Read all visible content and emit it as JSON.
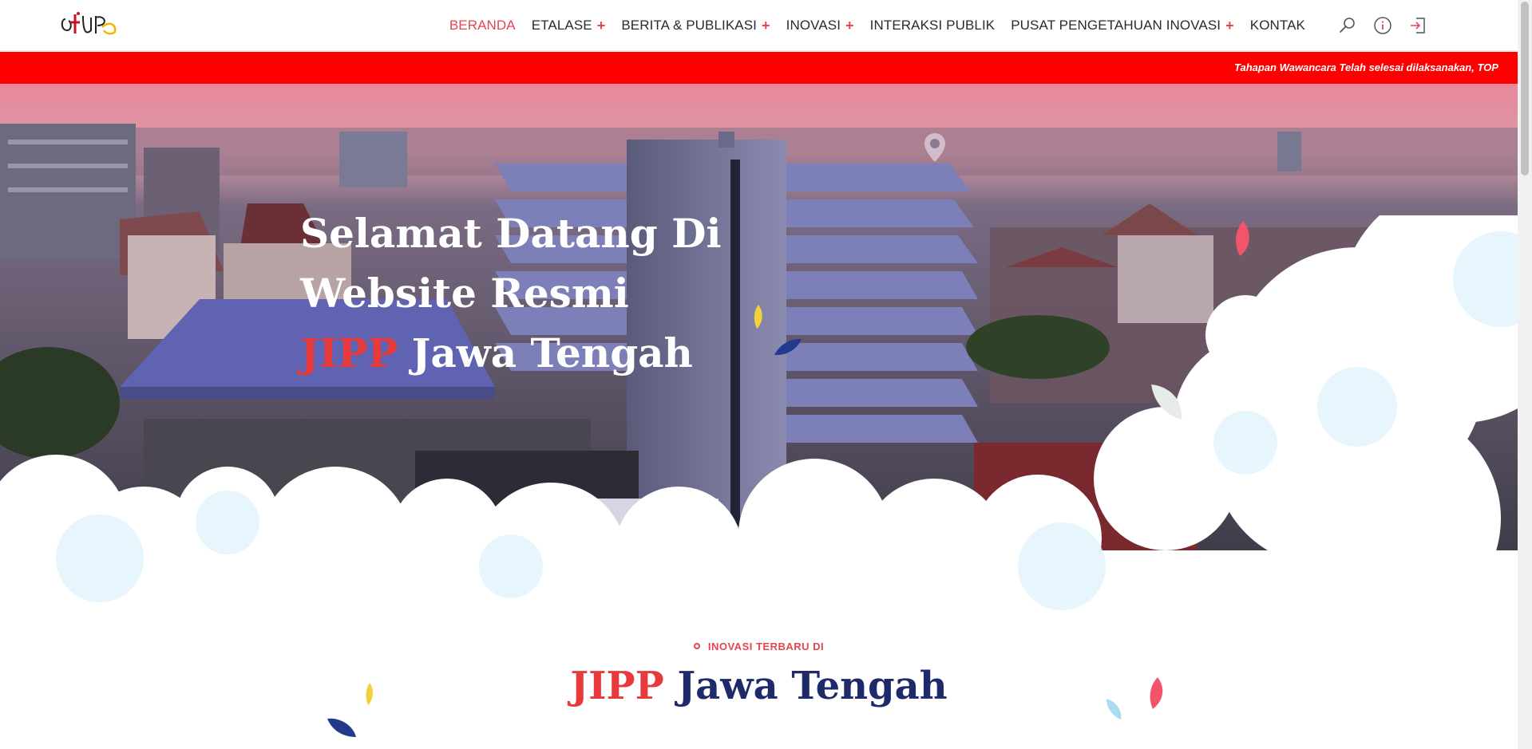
{
  "logo": {
    "alt": "JIPP logo"
  },
  "nav": {
    "items": [
      {
        "label": "BERANDA",
        "has_submenu": false,
        "active": true
      },
      {
        "label": "ETALASE",
        "has_submenu": true,
        "active": false
      },
      {
        "label": "BERITA & PUBLIKASI",
        "has_submenu": true,
        "active": false
      },
      {
        "label": "INOVASI",
        "has_submenu": true,
        "active": false
      },
      {
        "label": "INTERAKSI PUBLIK",
        "has_submenu": false,
        "active": false
      },
      {
        "label": "PUSAT PENGETAHUAN INOVASI",
        "has_submenu": true,
        "active": false
      },
      {
        "label": "KONTAK",
        "has_submenu": false,
        "active": false
      }
    ],
    "submenu_marker": "+",
    "icons": [
      "search-icon",
      "info-icon",
      "login-icon"
    ]
  },
  "ticker": {
    "text": "Tahapan Wawancara Telah selesai dilaksanakan, TOP"
  },
  "hero": {
    "line1": "Selamat Datang Di",
    "line2": "Website Resmi",
    "line3_highlight": "JIPP",
    "line3_rest": " Jawa Tengah"
  },
  "section": {
    "kicker": "INOVASI TERBARU DI",
    "title_highlight": "JIPP",
    "title_rest": " Jawa Tengah"
  },
  "colors": {
    "accent": "#e4464f",
    "ticker_bg": "#ff0000",
    "navy": "#1f2a6b"
  }
}
